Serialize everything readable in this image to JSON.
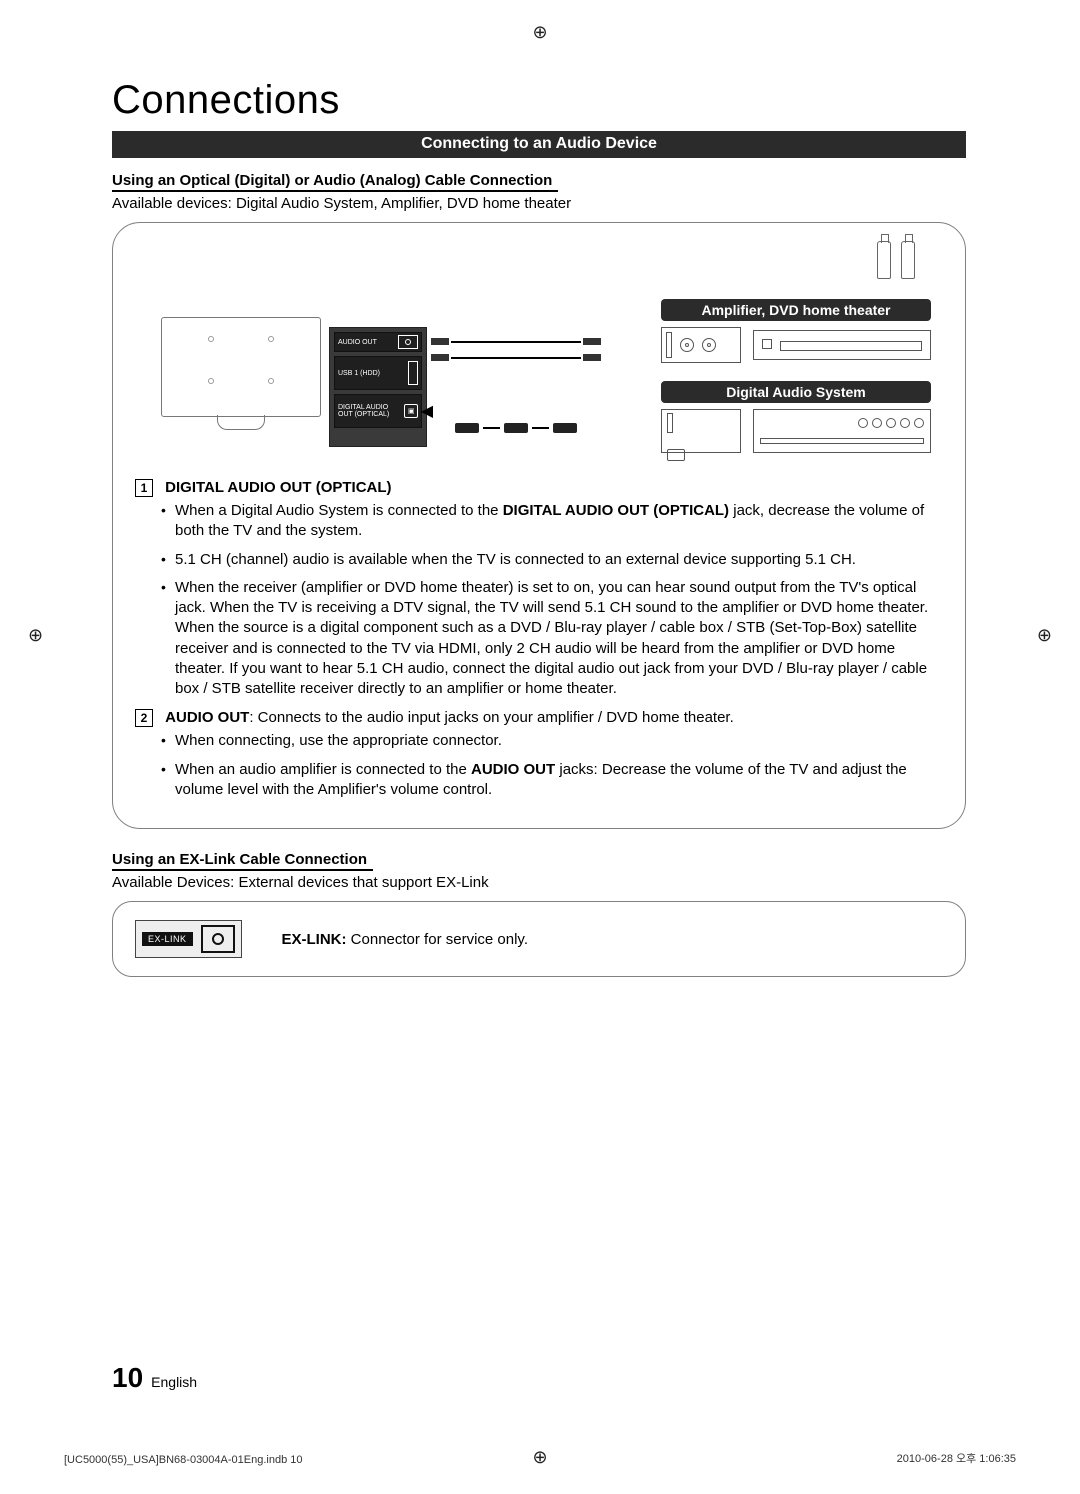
{
  "crop_mark": "⊕",
  "title": "Connections",
  "section_bar": "Connecting to an Audio Device",
  "audio": {
    "header": "Using an Optical (Digital) or Audio (Analog) Cable Connection",
    "desc": "Available devices: Digital Audio System, Amplifier, DVD home theater",
    "ports": {
      "audio_out": "AUDIO OUT",
      "usb": "USB 1 (HDD)",
      "digital_out": "DIGITAL AUDIO OUT (OPTICAL)"
    },
    "dev_amp_label": "Amplifier, DVD home theater",
    "dev_das_label": "Digital Audio System",
    "item1": {
      "num": "1",
      "lead": "DIGITAL AUDIO OUT (OPTICAL)",
      "b1a": "When a Digital Audio System is connected to the ",
      "b1b": "DIGITAL AUDIO OUT (OPTICAL)",
      "b1c": " jack, decrease the volume of both the TV and the system.",
      "b2": "5.1 CH (channel) audio is available when the TV is connected to an external device supporting 5.1 CH.",
      "b3": "When the receiver (amplifier or DVD home theater) is set to on, you can hear sound output from the TV's optical jack. When the TV is receiving a DTV signal, the TV will send 5.1 CH sound to the amplifier or DVD home theater. When the source is a digital component such as a DVD / Blu-ray player / cable box / STB (Set-Top-Box) satellite receiver and is connected to the TV via HDMI, only 2 CH audio will be heard from the amplifier or DVD home theater. If you want to hear 5.1 CH audio, connect the digital audio out jack from your DVD / Blu-ray player / cable box / STB satellite receiver directly to an amplifier or home theater."
    },
    "item2": {
      "num": "2",
      "lead": "AUDIO OUT",
      "rest": ": Connects to the audio input jacks on your amplifier / DVD home theater.",
      "b1": "When connecting, use the appropriate connector.",
      "b2a": "When an audio amplifier is connected to the ",
      "b2b": "AUDIO OUT",
      "b2c": " jacks: Decrease the volume of the TV and adjust the volume level with the Amplifier's volume control."
    }
  },
  "exlink": {
    "header": "Using an EX-Link Cable Connection",
    "desc": "Available Devices: External devices that support EX-Link",
    "port_label": "EX-LINK",
    "lead": "EX-LINK:",
    "text": " Connector for service only."
  },
  "footer": {
    "page": "10",
    "lang": "English"
  },
  "indb": "[UC5000(55)_USA]BN68-03004A-01Eng.indb   10",
  "timestamp": "2010-06-28   오후 1:06:35"
}
